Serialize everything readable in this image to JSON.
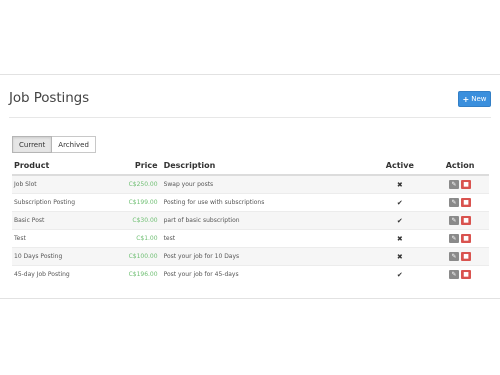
{
  "header": {
    "title": "Job Postings",
    "new_button_label": "New",
    "new_button_icon": "plus-icon",
    "new_button_color": "#3a8fdd"
  },
  "tabs": [
    {
      "label": "Current",
      "active": true
    },
    {
      "label": "Archived",
      "active": false
    }
  ],
  "table": {
    "columns": [
      "Product",
      "Price",
      "Description",
      "Active",
      "Action"
    ],
    "rows": [
      {
        "product": "Job Slot",
        "price": "C$250.00",
        "description": "Swap your posts",
        "active": "✖"
      },
      {
        "product": "Subscription Posting",
        "price": "C$199.00",
        "description": "Posting for use with subscriptions",
        "active": "✔"
      },
      {
        "product": "Basic Post",
        "price": "C$30.00",
        "description": "part of basic subscription",
        "active": "✔"
      },
      {
        "product": "Test",
        "price": "C$1.00",
        "description": "test",
        "active": "✖"
      },
      {
        "product": "10 Days Posting",
        "price": "C$100.00",
        "description": "Post your job for 10 Days",
        "active": "✖"
      },
      {
        "product": "45-day Job Posting",
        "price": "C$196.00",
        "description": "Post your job for 45-days",
        "active": "✔"
      }
    ],
    "price_color": "#6fbf73",
    "edit_icon": "pencil-icon",
    "delete_icon": "trash-icon",
    "delete_color": "#d9534f"
  }
}
